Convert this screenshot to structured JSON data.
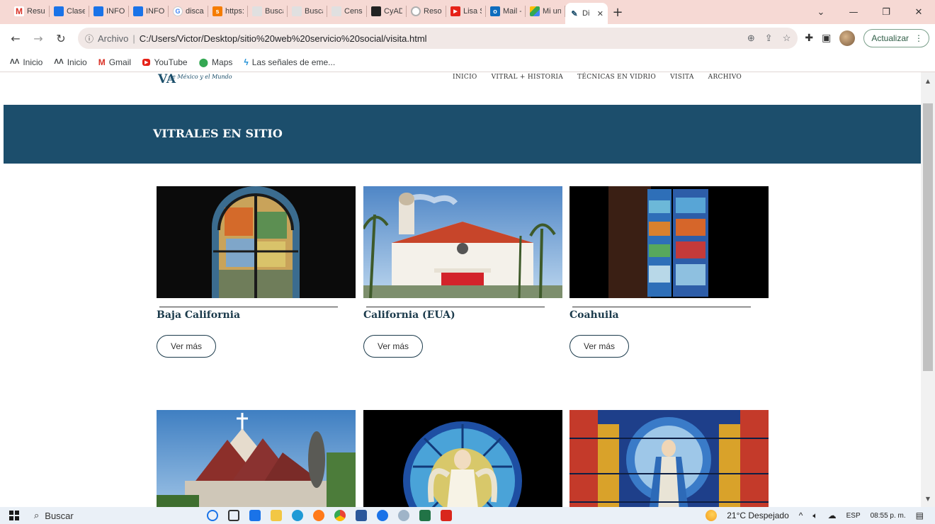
{
  "tabs": [
    {
      "label": "Result",
      "icon": "gmail-icon",
      "color": "#d93025"
    },
    {
      "label": "Clases",
      "icon": "classroom-icon",
      "color": "#1a73e8"
    },
    {
      "label": "INFOR",
      "icon": "classroom-icon",
      "color": "#1a73e8"
    },
    {
      "label": "INFOR",
      "icon": "classroom-icon",
      "color": "#1a73e8"
    },
    {
      "label": "discap",
      "icon": "google-icon",
      "color": "#4285f4"
    },
    {
      "label": "https:",
      "icon": "slides-icon",
      "color": "#f57c00"
    },
    {
      "label": "Busca",
      "icon": "search-site-icon",
      "color": "#9e9e9e"
    },
    {
      "label": "Busca",
      "icon": "search-site-icon",
      "color": "#9e9e9e"
    },
    {
      "label": "Censo",
      "icon": "search-site-icon",
      "color": "#9e9e9e"
    },
    {
      "label": "CyAD",
      "icon": "uam-icon",
      "color": "#222222"
    },
    {
      "label": "Reson",
      "icon": "loading-icon",
      "color": "#b0b0b0"
    },
    {
      "label": "Lisa S",
      "icon": "youtube-icon",
      "color": "#e62117"
    },
    {
      "label": "Mail -",
      "icon": "outlook-icon",
      "color": "#0f6cbd"
    },
    {
      "label": "Mi un",
      "icon": "drive-icon",
      "color": "#34a853"
    },
    {
      "label": "Di",
      "icon": "site-logo-icon",
      "color": "#1c4e6c"
    }
  ],
  "address": {
    "info_label": "Archivo",
    "url": "C:/Users/Victor/Desktop/sitio%20web%20servicio%20social/visita.html"
  },
  "update_button": "Actualizar",
  "bookmarks": [
    {
      "label": "Inicio",
      "icon": "uam-icon"
    },
    {
      "label": "Inicio",
      "icon": "uam-icon"
    },
    {
      "label": "Gmail",
      "icon": "gmail-icon"
    },
    {
      "label": "YouTube",
      "icon": "youtube-icon"
    },
    {
      "label": "Maps",
      "icon": "maps-pin-icon"
    },
    {
      "label": "Las señales de eme...",
      "icon": "flutter-icon"
    }
  ],
  "site": {
    "logo_letters": "VA",
    "logo_tag": "de México y el Mundo",
    "nav": [
      "INICIO",
      "VITRAL + HISTORIA",
      "TÉCNICAS EN VIDRIO",
      "VISITA",
      "ARCHIVO"
    ],
    "banner_title": "VITRALES EN SITIO",
    "cards": [
      {
        "title": "Baja California",
        "button": "Ver más"
      },
      {
        "title": "California (EUA)",
        "button": "Ver más"
      },
      {
        "title": "Coahuila",
        "button": "Ver más"
      },
      {
        "title": "",
        "button": ""
      },
      {
        "title": "",
        "button": ""
      },
      {
        "title": "",
        "button": ""
      }
    ]
  },
  "taskbar": {
    "search_label": "Buscar",
    "weather": "21°C  Despejado",
    "lang": "ESP",
    "time": "08:55 p. m."
  }
}
